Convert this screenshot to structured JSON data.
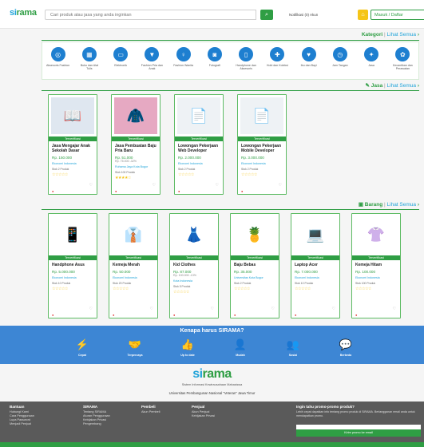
{
  "header": {
    "logo_a": "si",
    "logo_b": "rama",
    "search_placeholder": "Cari produk atau jasa yang anda inginkan",
    "search_icon": "search-icon",
    "links": "Notifikasi (0)  Akun",
    "home_icon": "home-icon",
    "login_label": "Masuk / Daftar"
  },
  "kategori": {
    "title": "Kategori",
    "sep": "|",
    "more": "Lihat Semua",
    "items": [
      {
        "label": "Aksesoris Fashion",
        "icon": "glasses-icon",
        "glyph": "◎"
      },
      {
        "label": "Buku dan Alat Tulis",
        "icon": "book-icon",
        "glyph": "▦"
      },
      {
        "label": "Elektronik",
        "icon": "tv-icon",
        "glyph": "▭"
      },
      {
        "label": "Fashion Pria dan Anak",
        "icon": "shirt-icon",
        "glyph": "▼"
      },
      {
        "label": "Fashion Wanita",
        "icon": "dress-icon",
        "glyph": "♀"
      },
      {
        "label": "Fotografi",
        "icon": "camera-icon",
        "glyph": "◙"
      },
      {
        "label": "Handphone dan Aksesoris",
        "icon": "phone-icon",
        "glyph": "▯"
      },
      {
        "label": "Hobi dan Koleksi",
        "icon": "gamepad-icon",
        "glyph": "✚"
      },
      {
        "label": "Ibu dan Bayi",
        "icon": "stroller-icon",
        "glyph": "♥"
      },
      {
        "label": "Jam Tangan",
        "icon": "watch-icon",
        "glyph": "◷"
      },
      {
        "label": "Jasa",
        "icon": "service-icon",
        "glyph": "✦"
      },
      {
        "label": "Kecantikan dan Perawatan",
        "icon": "beauty-icon",
        "glyph": "✿"
      }
    ]
  },
  "jasa": {
    "icon": "wrench-icon",
    "title": "Jasa",
    "sep": "|",
    "more": "Lihat Semua",
    "cards": [
      {
        "badge": "Terverifikasi",
        "name": "Jasa Mengajar Anak Sekolah Dasar",
        "price": "Rp. 150.000",
        "old": "",
        "loc": "Ekonomi Indonesia",
        "sold": "Stok 2 Produk",
        "stars": "☆☆☆☆☆",
        "img": "📖",
        "bg": "#dfe7f0"
      },
      {
        "badge": "Terverifikasi",
        "name": "Jasa Pembuatan Baju Pria Baru",
        "price": "Rp. 51.000",
        "old": "Rp. 75.000  -32%",
        "loc": "Ruhama Jaya Kota Bogor",
        "sold": "Stok 100 Produk",
        "stars": "★★★★☆",
        "img": "🧥",
        "bg": "#e6a9c2"
      },
      {
        "badge": "Terverifikasi",
        "name": "Lowongan Pekerjaan Web Developer",
        "price": "Rp. 2.000.000",
        "old": "",
        "loc": "Ekonomi Indonesia",
        "sold": "Stok 2 Produk",
        "stars": "☆☆☆☆☆",
        "img": "📄",
        "bg": "#eef2f5"
      },
      {
        "badge": "Terverifikasi",
        "name": "Lowongan Pekerjaan Mobile Developer",
        "price": "Rp. 3.000.000",
        "old": "",
        "loc": "Ekonomi Indonesia",
        "sold": "Stok 2 Produk",
        "stars": "☆☆☆☆☆",
        "img": "📄",
        "bg": "#eef2f5"
      }
    ]
  },
  "barang": {
    "icon": "box-icon",
    "title": "Barang",
    "sep": "|",
    "more": "Lihat Semua",
    "cards": [
      {
        "badge": "Terverifikasi",
        "name": "Handphone Asus",
        "price": "Rp. 5.000.000",
        "old": "",
        "loc": "Ekonomi Indonesia",
        "sold": "Stok 10 Produk",
        "stars": "☆☆☆☆☆",
        "img": "📱",
        "bg": "#ffffff"
      },
      {
        "badge": "Terverifikasi",
        "name": "Kemeja Merah",
        "price": "Rp. 50.000",
        "old": "",
        "loc": "Ekonomi Indonesia",
        "sold": "Stok 20 Produk",
        "stars": "☆☆☆☆☆",
        "img": "👔",
        "bg": "#ffffff"
      },
      {
        "badge": "Terverifikasi",
        "name": "Kid Clothes",
        "price": "Rp. 87.000",
        "old": "Rp. 100.000  -13%",
        "loc": "Kota Indonesia",
        "sold": "Stok 5 Produk",
        "stars": "☆☆☆☆☆",
        "img": "👗",
        "bg": "#ffffff"
      },
      {
        "badge": "Terverifikasi",
        "name": "Baju Bebas",
        "price": "Rp. 35.000",
        "old": "",
        "loc": "Universitas Kota Bogor",
        "sold": "Stok 2 Produk",
        "stars": "☆☆☆☆☆",
        "img": "🍍",
        "bg": "#ffffff"
      },
      {
        "badge": "Terverifikasi",
        "name": "Laptop Acer",
        "price": "Rp. 7.000.000",
        "old": "",
        "loc": "Ekonomi Indonesia",
        "sold": "Stok 10 Produk",
        "stars": "☆☆☆☆☆",
        "img": "💻",
        "bg": "#ffffff"
      },
      {
        "badge": "Terverifikasi",
        "name": "Kemeja Hitam",
        "price": "Rp. 100.000",
        "old": "",
        "loc": "Ekonomi Indonesia",
        "sold": "Stok 100 Produk",
        "stars": "☆☆☆☆☆",
        "img": "👚",
        "bg": "#ffffff"
      }
    ]
  },
  "why": {
    "title": "Kenapa harus SIRAMA?",
    "items": [
      {
        "label": "Cepat",
        "glyph": "⚡",
        "icon": "lightning-icon"
      },
      {
        "label": "Terpercaya",
        "glyph": "🤝",
        "icon": "handshake-icon"
      },
      {
        "label": "Up to date",
        "glyph": "👍",
        "icon": "thumbs-up-icon"
      },
      {
        "label": "Mudah",
        "glyph": "👤",
        "icon": "user-icon"
      },
      {
        "label": "Sosial",
        "glyph": "👥",
        "icon": "group-icon"
      },
      {
        "label": "Berbeda",
        "glyph": "💬",
        "icon": "people-icon"
      }
    ]
  },
  "brand": {
    "logo_a": "si",
    "logo_b": "rama",
    "subtitle": "Sistem Informasi Kewirausahaan Mahasiswa",
    "university": "Universitas Pembangunan Nasional \"Veteran\" Jawa Timur"
  },
  "footer": {
    "cols": [
      {
        "title": "Bantuan",
        "items": [
          "Hubungi Kami",
          "Cara Penggunaan",
          "Lupa Password",
          "Menjadi Penjual"
        ]
      },
      {
        "title": "SIRAMA",
        "items": [
          "Tentang SIRAMA",
          "Aturan Penggunaan",
          "Kebijakan Privasi",
          "Pengembang"
        ]
      },
      {
        "title": "Pembeli",
        "items": [
          "Akun Pembeli"
        ]
      },
      {
        "title": "Penjual",
        "items": [
          "Akun Penjual",
          "Kebijakan Privasi"
        ]
      }
    ],
    "promo_title": "Ingin tahu promo-promo produk?",
    "promo_text": "Lebih cepat dapatkan info tentang promo produk di SIRAMA. Berlangganan email anda untuk mendapatkan promo.",
    "promo_btn": "Kirim promo ke email"
  }
}
